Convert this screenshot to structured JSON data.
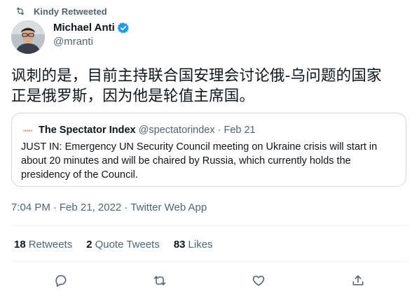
{
  "retweet_context": {
    "text": "Kindy Retweeted",
    "icon": "retweet-icon"
  },
  "author": {
    "name": "Michael Anti",
    "handle": "@mranti",
    "verified": true,
    "verified_color": "#1d9bf0"
  },
  "tweet": {
    "text_line1": "讽刺的是，目前主持联合国安理会讨论俄-乌问题的国家",
    "text_line2": "正是俄罗斯，因为他是轮值主席国。"
  },
  "quoted_tweet": {
    "avatar_label": "INDEX",
    "name": "The Spectator Index",
    "handle": "@spectatorindex",
    "separator": "·",
    "date": "Feb 21",
    "text": "JUST IN: Emergency UN Security Council meeting on Ukraine crisis will start in about 20 minutes and will be chaired by Russia, which currently holds the presidency of the Council."
  },
  "meta": {
    "time": "7:04 PM",
    "separator": "·",
    "date": "Feb 21, 2022",
    "source": "Twitter Web App"
  },
  "stats": {
    "retweets_count": "18",
    "retweets_label": "Retweets",
    "quotes_count": "2",
    "quotes_label": "Quote Tweets",
    "likes_count": "83",
    "likes_label": "Likes"
  },
  "actions": [
    "reply-icon",
    "retweet-icon",
    "like-icon",
    "share-icon"
  ],
  "colors": {
    "text": "#0f1419",
    "secondary": "#536471",
    "border": "#cfd9de",
    "divider": "#eff3f4"
  }
}
